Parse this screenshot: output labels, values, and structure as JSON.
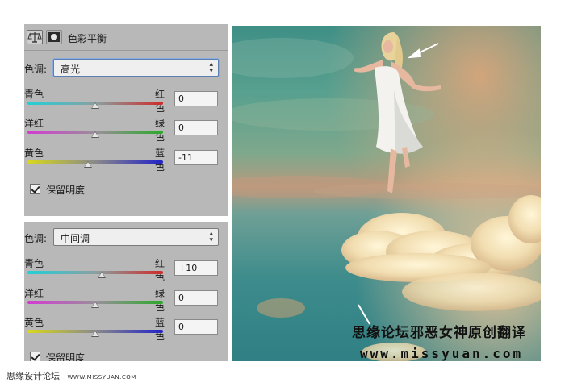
{
  "panel_title": "色彩平衡",
  "tone_label": "色调:",
  "top": {
    "tone_value": "高光",
    "sliders": [
      {
        "left": "青色",
        "right": "红色",
        "value": "0",
        "level": 0
      },
      {
        "left": "洋红",
        "right": "绿色",
        "value": "0",
        "level": 0
      },
      {
        "left": "黄色",
        "right": "蓝色",
        "value": "-11",
        "level": -11
      }
    ],
    "preserve_label": "保留明度",
    "preserve_checked": true
  },
  "bottom": {
    "tone_value": "中间调",
    "sliders": [
      {
        "left": "青色",
        "right": "红色",
        "value": "+10",
        "level": 10
      },
      {
        "left": "洋红",
        "right": "绿色",
        "value": "0",
        "level": 0
      },
      {
        "left": "黄色",
        "right": "蓝色",
        "value": "0",
        "level": 0
      }
    ],
    "preserve_label": "保留明度",
    "preserve_checked": true
  },
  "watermark": {
    "cn": "思缘论坛邪恶女神原创翻译",
    "url": "www.missyuan.com"
  },
  "footer": {
    "cn": "思缘设计论坛",
    "url": "WWW.MISSYUAN.COM"
  },
  "icons": {
    "adjustment": "scales-icon",
    "mask": "layer-mask-icon",
    "dropdown": "up-down-arrows-icon"
  }
}
